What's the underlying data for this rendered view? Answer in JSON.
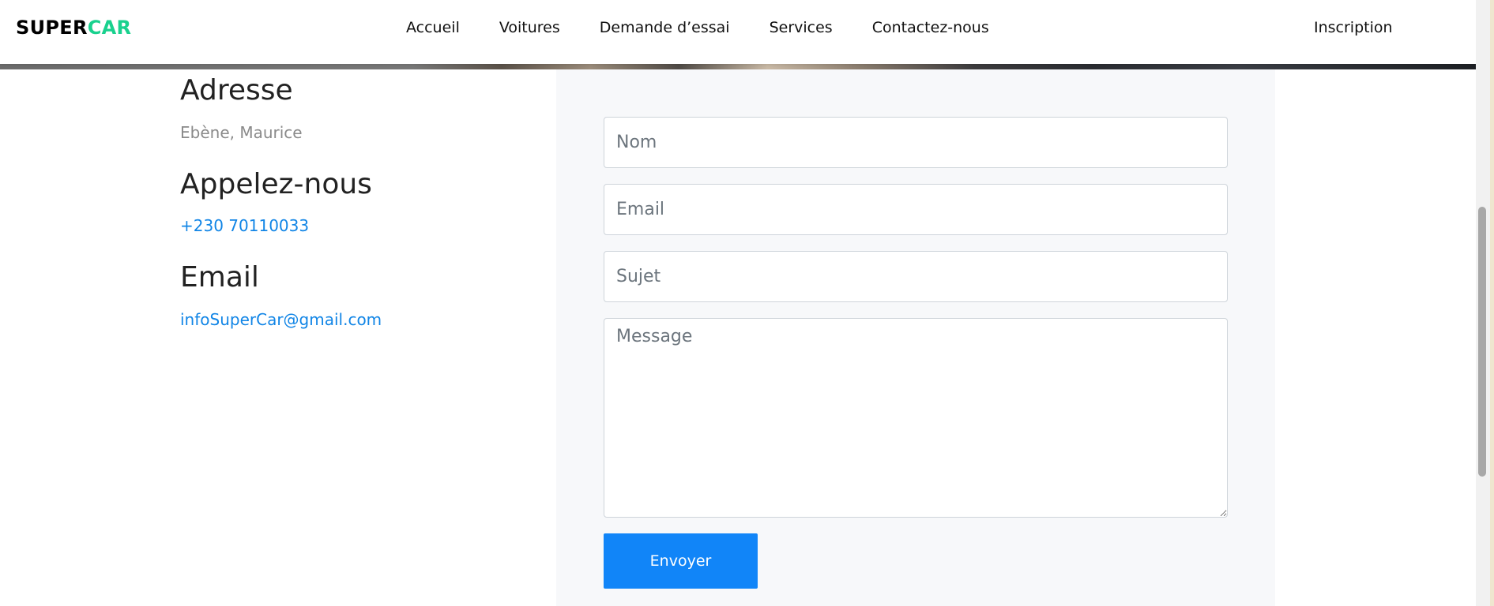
{
  "brand": {
    "part1": "SUPER",
    "part2": "CAR",
    "accent_color": "#19d18e"
  },
  "nav": {
    "items": [
      {
        "label": "Accueil"
      },
      {
        "label": "Voitures"
      },
      {
        "label": "Demande d’essai"
      },
      {
        "label": "Services"
      },
      {
        "label": "Contactez-nous"
      }
    ],
    "right_label": "Inscription"
  },
  "contact": {
    "address_title": "Adresse",
    "address_value": "Ebène, Maurice",
    "phone_title": "Appelez-nous",
    "phone_value": "+230 70110033",
    "email_title": "Email",
    "email_value": "infoSuperCar@gmail.com",
    "link_color": "#1185e6"
  },
  "form": {
    "name_placeholder": "Nom",
    "email_placeholder": "Email",
    "subject_placeholder": "Sujet",
    "message_placeholder": "Message",
    "submit_label": "Envoyer",
    "submit_color": "#1185f8"
  }
}
